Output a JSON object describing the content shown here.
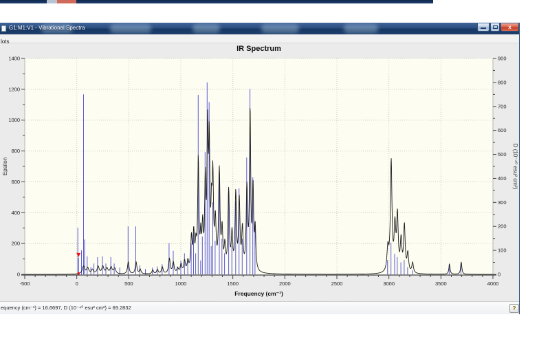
{
  "background_window": {
    "strip_color": "#14305c",
    "minmax_color": "#b8c4d4",
    "close_color": "#d06a5a"
  },
  "window": {
    "title": "G1:M1:V1 - Vibrational Spectra",
    "menu": [
      {
        "label": "lots"
      }
    ],
    "caption_buttons": {
      "minimize": "minimize",
      "maximize": "maximize",
      "close": "x"
    },
    "status_text": "equency (cm⁻¹) = 16.6697, D (10⁻⁴⁰ esu² cm²) = 69.2832",
    "help_label": "?"
  },
  "chart_data": {
    "type": "line",
    "subtype": "IR stick spectrum with convolved envelope",
    "title": "IR Spectrum",
    "x_axis": {
      "label": "Frequency (cm⁻¹)",
      "min": -500,
      "max": 4000,
      "major": 500,
      "minor": 100
    },
    "y_left": {
      "label": "Epsilon",
      "min": 0,
      "max": 1400,
      "major": 200,
      "minor": 100
    },
    "y_right": {
      "label": "D (10⁻⁴⁰ esu² cm²)",
      "min": 0,
      "max": 900,
      "major": 100,
      "minor": 50
    },
    "grid": true,
    "selected_line": {
      "frequency": 16.6697,
      "D": 69.2832
    },
    "sticks_units": "[frequency cm-1, D 10^-40 esu^2 cm^2] on right axis",
    "sticks": [
      [
        10,
        195
      ],
      [
        17,
        69
      ],
      [
        45,
        100
      ],
      [
        65,
        750
      ],
      [
        75,
        145
      ],
      [
        100,
        75
      ],
      [
        135,
        30
      ],
      [
        165,
        45
      ],
      [
        200,
        72
      ],
      [
        247,
        75
      ],
      [
        280,
        45
      ],
      [
        327,
        72
      ],
      [
        360,
        45
      ],
      [
        413,
        28
      ],
      [
        493,
        200
      ],
      [
        567,
        200
      ],
      [
        607,
        38
      ],
      [
        660,
        22
      ],
      [
        727,
        28
      ],
      [
        773,
        33
      ],
      [
        820,
        42
      ],
      [
        887,
        130
      ],
      [
        927,
        98
      ],
      [
        967,
        33
      ],
      [
        1000,
        58
      ],
      [
        1035,
        88
      ],
      [
        1067,
        68
      ],
      [
        1100,
        128
      ],
      [
        1122,
        178
      ],
      [
        1143,
        88
      ],
      [
        1167,
        748
      ],
      [
        1190,
        58
      ],
      [
        1207,
        158
      ],
      [
        1233,
        510
      ],
      [
        1253,
        800
      ],
      [
        1272,
        718
      ],
      [
        1292,
        118
      ],
      [
        1307,
        300
      ],
      [
        1330,
        140
      ],
      [
        1370,
        430
      ],
      [
        1395,
        148
      ],
      [
        1420,
        88
      ],
      [
        1460,
        347
      ],
      [
        1490,
        118
      ],
      [
        1527,
        304
      ],
      [
        1560,
        358
      ],
      [
        1590,
        148
      ],
      [
        1633,
        487
      ],
      [
        1665,
        774
      ],
      [
        1692,
        404
      ],
      [
        1713,
        222
      ],
      [
        2987,
        60
      ],
      [
        3020,
        132
      ],
      [
        3055,
        85
      ],
      [
        3080,
        72
      ],
      [
        3115,
        50
      ],
      [
        3147,
        60
      ],
      [
        3180,
        30
      ],
      [
        3227,
        18
      ],
      [
        3580,
        43
      ],
      [
        3693,
        45
      ]
    ],
    "envelope_units": "[frequency cm-1, epsilon peak on left axis, half-width cm-1]",
    "envelope_peaks": [
      [
        65,
        50,
        14
      ],
      [
        105,
        38,
        12
      ],
      [
        150,
        28,
        12
      ],
      [
        205,
        48,
        12
      ],
      [
        250,
        48,
        12
      ],
      [
        290,
        35,
        12
      ],
      [
        330,
        42,
        12
      ],
      [
        365,
        35,
        12
      ],
      [
        495,
        78,
        9
      ],
      [
        570,
        78,
        9
      ],
      [
        610,
        30,
        9
      ],
      [
        730,
        25,
        9
      ],
      [
        775,
        28,
        9
      ],
      [
        822,
        45,
        9
      ],
      [
        890,
        98,
        9
      ],
      [
        928,
        72,
        9
      ],
      [
        970,
        30,
        9
      ],
      [
        1002,
        55,
        9
      ],
      [
        1036,
        75,
        9
      ],
      [
        1068,
        68,
        9
      ],
      [
        1102,
        215,
        8
      ],
      [
        1124,
        235,
        8
      ],
      [
        1145,
        150,
        8
      ],
      [
        1168,
        705,
        7
      ],
      [
        1192,
        200,
        7
      ],
      [
        1210,
        260,
        7
      ],
      [
        1235,
        540,
        7
      ],
      [
        1257,
        850,
        7
      ],
      [
        1273,
        760,
        7
      ],
      [
        1295,
        330,
        7
      ],
      [
        1308,
        560,
        7
      ],
      [
        1332,
        300,
        8
      ],
      [
        1370,
        640,
        8
      ],
      [
        1397,
        250,
        8
      ],
      [
        1423,
        150,
        8
      ],
      [
        1460,
        517,
        8
      ],
      [
        1492,
        230,
        8
      ],
      [
        1528,
        495,
        8
      ],
      [
        1562,
        450,
        8
      ],
      [
        1592,
        260,
        8
      ],
      [
        1635,
        520,
        8
      ],
      [
        1666,
        1020,
        7
      ],
      [
        1694,
        520,
        7
      ],
      [
        1715,
        260,
        7
      ],
      [
        2990,
        150,
        10
      ],
      [
        3022,
        713,
        9
      ],
      [
        3058,
        280,
        9
      ],
      [
        3082,
        357,
        9
      ],
      [
        3117,
        200,
        9
      ],
      [
        3149,
        300,
        9
      ],
      [
        3182,
        120,
        9
      ],
      [
        3228,
        67,
        9
      ],
      [
        3582,
        65,
        7
      ],
      [
        3695,
        80,
        7
      ]
    ],
    "colors": {
      "stick": "#5b5bd6",
      "envelope": "#1a1a1a",
      "selected_marker": "#ee1111",
      "grid": "#c9cfc0",
      "plot_bg": "#fdfdf2",
      "axis": "#444444",
      "tick_text": "#222222"
    }
  }
}
